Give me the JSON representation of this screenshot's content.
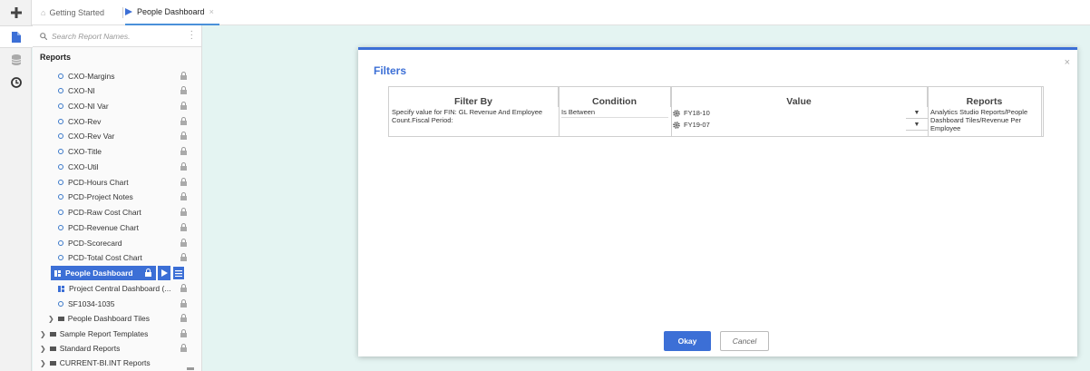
{
  "tabs": [
    {
      "label": "Getting Started",
      "icon": "home-icon"
    },
    {
      "label": "People Dashboard",
      "icon": "play-icon",
      "close": "×"
    }
  ],
  "sidebar": {
    "search_placeholder": "Search Report Names.",
    "heading": "Reports",
    "items": [
      {
        "label": "CXO-Margins"
      },
      {
        "label": "CXO-NI"
      },
      {
        "label": "CXO-NI Var"
      },
      {
        "label": "CXO-Rev"
      },
      {
        "label": "CXO-Rev Var"
      },
      {
        "label": "CXO-Title"
      },
      {
        "label": "CXO-Util"
      },
      {
        "label": "PCD-Hours Chart"
      },
      {
        "label": "PCD-Project Notes"
      },
      {
        "label": "PCD-Raw Cost Chart"
      },
      {
        "label": "PCD-Revenue Chart"
      },
      {
        "label": "PCD-Scorecard"
      },
      {
        "label": "PCD-Total Cost Chart"
      },
      {
        "label": "People Dashboard",
        "selected": true
      },
      {
        "label": "Project Central Dashboard (..."
      },
      {
        "label": "SF1034-1035"
      }
    ],
    "folders": [
      {
        "label": "People Dashboard Tiles"
      },
      {
        "label": "Sample Report Templates"
      },
      {
        "label": "Standard Reports"
      },
      {
        "label": "CURRENT-BI.INT Reports"
      }
    ]
  },
  "modal": {
    "title": "Filters",
    "close": "×",
    "columns": [
      "Filter By",
      "Condition",
      "Value",
      "Reports"
    ],
    "row": {
      "filter_by": "Specify value for FIN: GL Revenue And Employee Count.Fiscal Period:",
      "condition": "Is Between",
      "values": [
        "FY18-10",
        "FY19-07"
      ],
      "reports": "Analytics Studio Reports/People Dashboard Tiles/Revenue Per Employee"
    },
    "okay_label": "Okay",
    "cancel_label": "Cancel"
  },
  "colors": {
    "accent": "#3c6fd6",
    "background": "#e4f4f2"
  }
}
